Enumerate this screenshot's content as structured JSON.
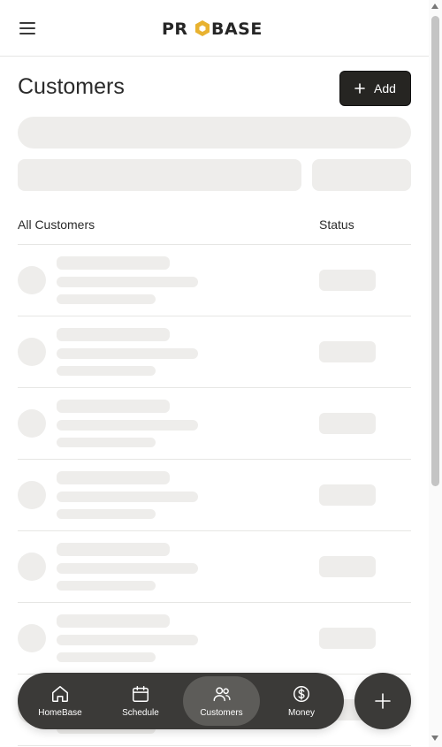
{
  "header": {
    "logo_text": "PROBASE",
    "menu_icon": "hamburger-menu-icon"
  },
  "main": {
    "title": "Customers",
    "add_button_label": "Add",
    "table": {
      "columns": [
        "All Customers",
        "Status"
      ]
    }
  },
  "bottom_nav": {
    "items": [
      {
        "label": "HomeBase",
        "icon": "home-icon"
      },
      {
        "label": "Schedule",
        "icon": "calendar-icon"
      },
      {
        "label": "Customers",
        "icon": "users-icon",
        "active": true
      },
      {
        "label": "Money",
        "icon": "dollar-circle-icon"
      }
    ],
    "fab_icon": "plus-icon"
  },
  "colors": {
    "primary_dark": "#262522",
    "nav_bg": "#3b3a38",
    "nav_active": "#5d5c59",
    "skeleton": "#eeedeb",
    "logo_accent": "#e8b230"
  }
}
